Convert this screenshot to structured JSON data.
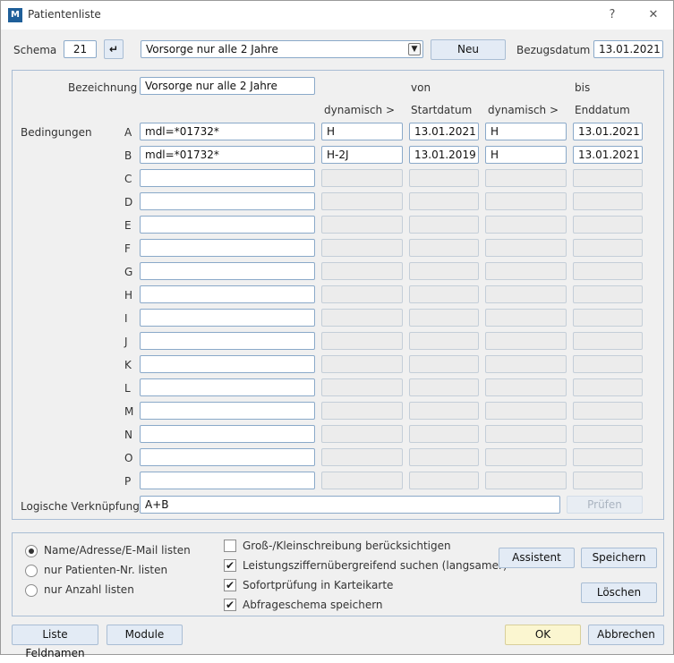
{
  "window": {
    "title": "Patientenliste",
    "help": "?",
    "close": "✕"
  },
  "header": {
    "schema_label": "Schema",
    "schema_value": "21",
    "schema_select": "Vorsorge nur alle 2 Jahre",
    "new_label": "Neu",
    "ref_date_label": "Bezugsdatum",
    "ref_date_value": "13.01.2021"
  },
  "form": {
    "bezeichnung_label": "Bezeichnung",
    "bezeichnung_value": "Vorsorge nur alle 2 Jahre",
    "von_label": "von",
    "bis_label": "bis",
    "col_dyn1": "dynamisch >",
    "col_start": "Startdatum",
    "col_dyn2": "dynamisch >",
    "col_end": "Enddatum",
    "bedingungen_label": "Bedingungen",
    "rows": [
      {
        "letter": "A",
        "cond": "mdl=*01732*",
        "dyn1": "H",
        "start": "13.01.2021",
        "dyn2": "H",
        "end": "13.01.2021"
      },
      {
        "letter": "B",
        "cond": "mdl=*01732*",
        "dyn1": "H-2J",
        "start": "13.01.2019",
        "dyn2": "H",
        "end": "13.01.2021"
      },
      {
        "letter": "C",
        "cond": "",
        "dyn1": "",
        "start": "",
        "dyn2": "",
        "end": ""
      },
      {
        "letter": "D",
        "cond": "",
        "dyn1": "",
        "start": "",
        "dyn2": "",
        "end": ""
      },
      {
        "letter": "E",
        "cond": "",
        "dyn1": "",
        "start": "",
        "dyn2": "",
        "end": ""
      },
      {
        "letter": "F",
        "cond": "",
        "dyn1": "",
        "start": "",
        "dyn2": "",
        "end": ""
      },
      {
        "letter": "G",
        "cond": "",
        "dyn1": "",
        "start": "",
        "dyn2": "",
        "end": ""
      },
      {
        "letter": "H",
        "cond": "",
        "dyn1": "",
        "start": "",
        "dyn2": "",
        "end": ""
      },
      {
        "letter": "I",
        "cond": "",
        "dyn1": "",
        "start": "",
        "dyn2": "",
        "end": ""
      },
      {
        "letter": "J",
        "cond": "",
        "dyn1": "",
        "start": "",
        "dyn2": "",
        "end": ""
      },
      {
        "letter": "K",
        "cond": "",
        "dyn1": "",
        "start": "",
        "dyn2": "",
        "end": ""
      },
      {
        "letter": "L",
        "cond": "",
        "dyn1": "",
        "start": "",
        "dyn2": "",
        "end": ""
      },
      {
        "letter": "M",
        "cond": "",
        "dyn1": "",
        "start": "",
        "dyn2": "",
        "end": ""
      },
      {
        "letter": "N",
        "cond": "",
        "dyn1": "",
        "start": "",
        "dyn2": "",
        "end": ""
      },
      {
        "letter": "O",
        "cond": "",
        "dyn1": "",
        "start": "",
        "dyn2": "",
        "end": ""
      },
      {
        "letter": "P",
        "cond": "",
        "dyn1": "",
        "start": "",
        "dyn2": "",
        "end": ""
      }
    ],
    "logic_label": "Logische Verknüpfung",
    "logic_value": "A+B",
    "check_label": "Prüfen"
  },
  "options": {
    "radio": [
      "Name/Adresse/E-Mail listen",
      "nur Patienten-Nr. listen",
      "nur Anzahl listen"
    ],
    "radio_selected": 0,
    "checks": [
      {
        "label": "Groß-/Kleinschreibung berücksichtigen",
        "checked": false
      },
      {
        "label": "Leistungsziffernübergreifend suchen (langsamer)",
        "checked": true
      },
      {
        "label": "Sofortprüfung in Karteikarte",
        "checked": true
      },
      {
        "label": "Abfrageschema speichern",
        "checked": true
      }
    ],
    "assistant_label": "Assistent",
    "save_label": "Speichern",
    "delete_label": "Löschen"
  },
  "footer": {
    "fields_label": "Liste Feldnamen",
    "modules_label": "Module",
    "ok_label": "OK",
    "cancel_label": "Abbrechen"
  }
}
